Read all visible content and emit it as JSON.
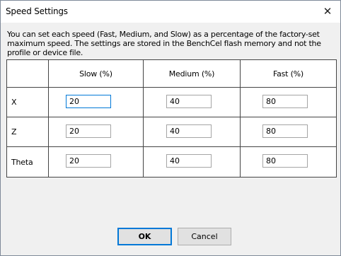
{
  "window": {
    "title": "Speed Settings",
    "close_glyph": "✕"
  },
  "description": "You can set each speed (Fast, Medium, and Slow) as a percentage of the factory-set maximum speed.  The settings are stored in the BenchCel flash memory and not the profile or device file.",
  "table": {
    "headers": [
      "",
      "Slow (%)",
      "Medium (%)",
      "Fast (%)"
    ],
    "rows": [
      {
        "label": "X",
        "slow": "20",
        "medium": "40",
        "fast": "80"
      },
      {
        "label": "Z",
        "slow": "20",
        "medium": "40",
        "fast": "80"
      },
      {
        "label": "Theta",
        "slow": "20",
        "medium": "40",
        "fast": "80"
      }
    ]
  },
  "buttons": {
    "ok": "OK",
    "cancel": "Cancel"
  },
  "colors": {
    "accent": "#0078d7",
    "dialog_bg": "#f0f0f0"
  }
}
